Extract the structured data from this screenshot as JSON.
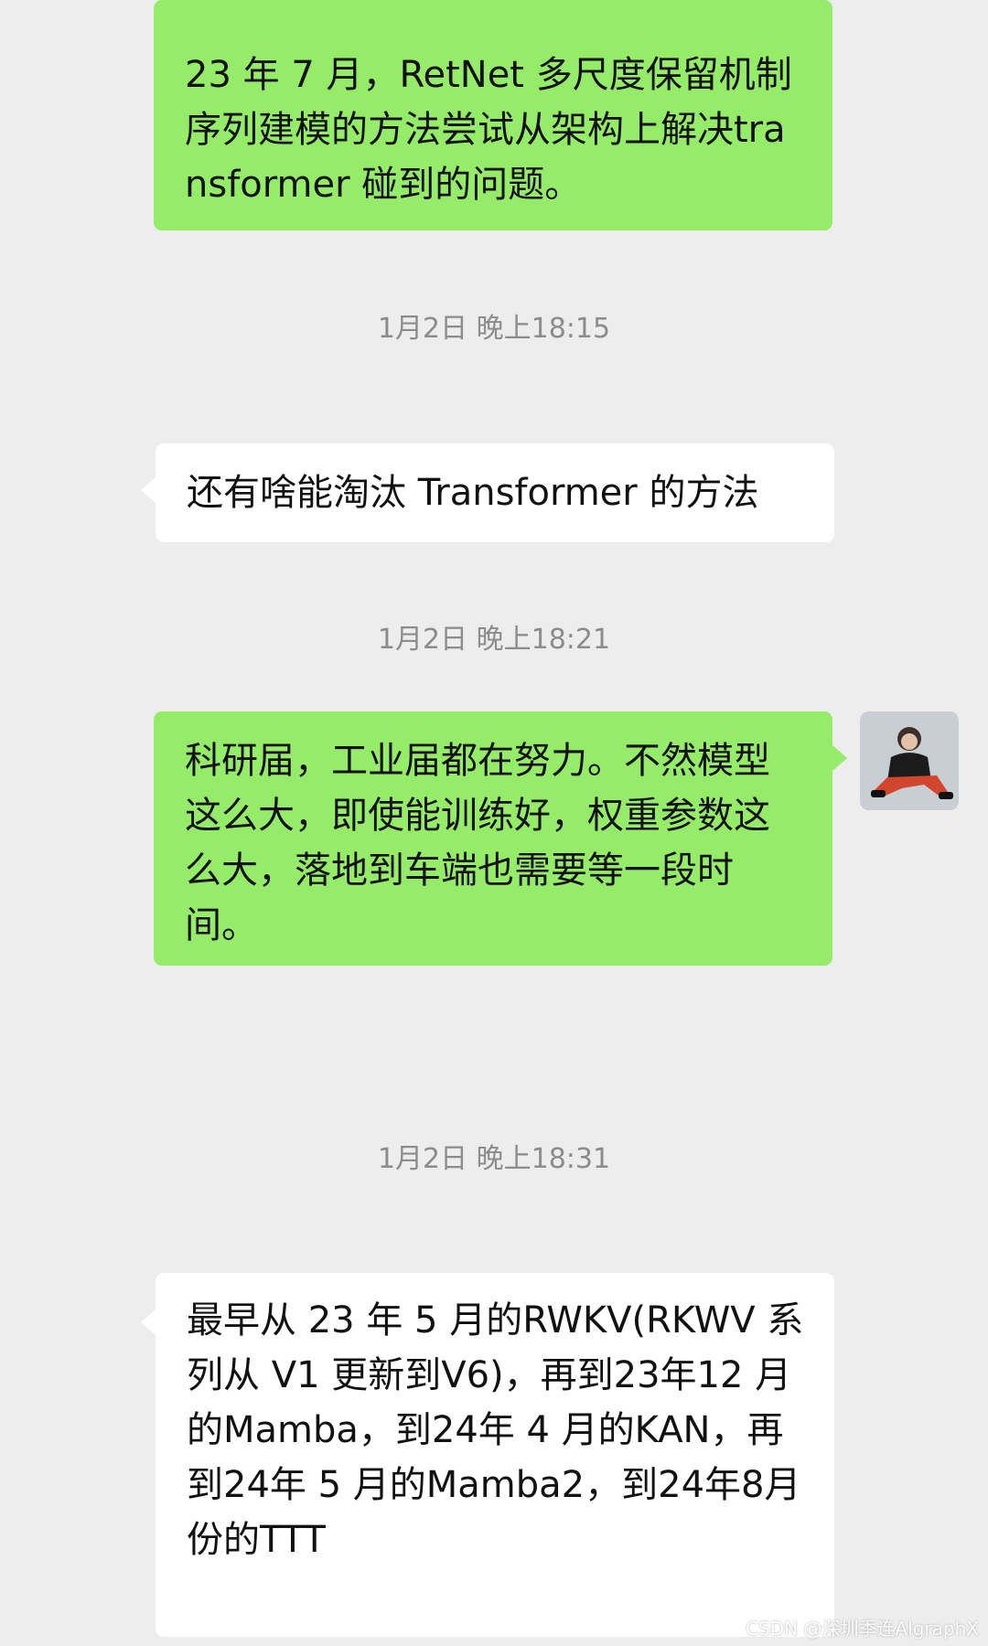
{
  "messages": [
    {
      "type": "sent",
      "text": "23 年 7 月，RetNet 多尺度保留机制序列建模的方法尝试从架构上解决transformer 碰到的问题。"
    },
    {
      "type": "timestamp",
      "text": "1月2日 晚上18:15"
    },
    {
      "type": "received",
      "text": "还有啥能淘汰 Transformer 的方法"
    },
    {
      "type": "timestamp",
      "text": "1月2日 晚上18:21"
    },
    {
      "type": "sent",
      "text": "科研届，工业届都在努力。不然模型这么大，即使能训练好，权重参数这么大，落地到车端也需要等一段时间。"
    },
    {
      "type": "timestamp",
      "text": "1月2日 晚上18:31"
    },
    {
      "type": "received",
      "text": "最早从 23 年 5 月的RWKV(RKWV 系列从 V1 更新到V6)，再到23年12 月的Mamba，到24年 4 月的KAN，再到24年 5 月的Mamba2，到24年8月份的TTT"
    }
  ],
  "watermark": "CSDN @深圳季连AlgraphX",
  "colors": {
    "background": "#ededed",
    "sent_bubble": "#95ec69",
    "received_bubble": "#ffffff",
    "timestamp_text": "#8c8c8c"
  },
  "icons": {
    "avatar": "user-avatar-photo"
  }
}
